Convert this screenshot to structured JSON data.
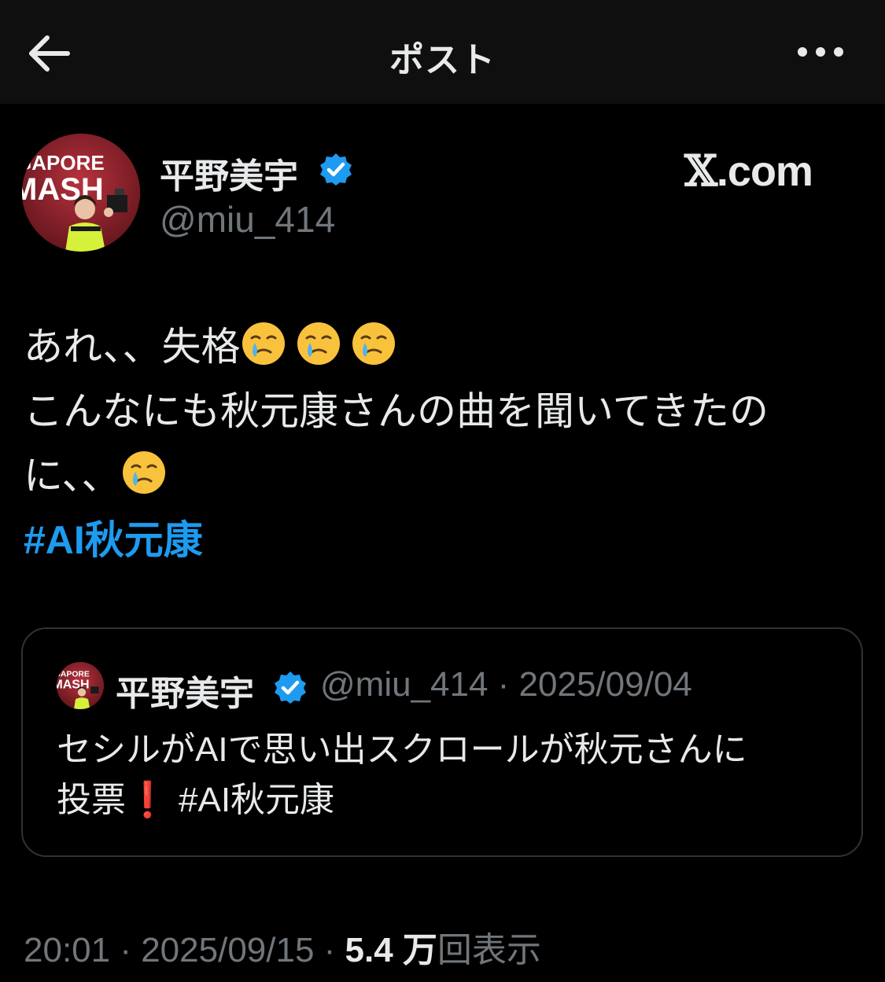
{
  "header": {
    "title": "ポスト",
    "back_icon": "arrow-left-icon",
    "more_icon": "more-horizontal-icon"
  },
  "post": {
    "author": {
      "display_name": "平野美宇",
      "handle": "@miu_414",
      "verified": true,
      "verified_color": "#1d9bf0",
      "avatar_text": [
        "GAPORE",
        "MASH"
      ]
    },
    "watermark": {
      "glyph": "𝕏",
      "text": ".com"
    },
    "text_line_1": "あれ、、失格",
    "text_line_2": "こんなにも秋元康さんの曲を聞いてきたの",
    "text_line_3": "に、、",
    "emoji_name": "face-holding-back-tears-icon",
    "hashtag": "#AI秋元康",
    "hashtag_color": "#1d9bf0"
  },
  "quoted_post": {
    "display_name": "平野美宇",
    "meta": "@miu_414 · 2025/09/04",
    "verified": true,
    "text_line_1": "セシルがAIで思い出スクロールが秋元さんに",
    "text_line_2": "投票❗️ #AI秋元康"
  },
  "footer": {
    "time_date": "20:01 · 2025/09/15 · ",
    "views_count": "5.4 万",
    "views_label": "回表示"
  },
  "colors": {
    "background": "#000000",
    "header_background": "#0f0f0f",
    "primary_text": "#e7e9ea",
    "secondary_text": "#71767b",
    "border": "#2f3336"
  }
}
